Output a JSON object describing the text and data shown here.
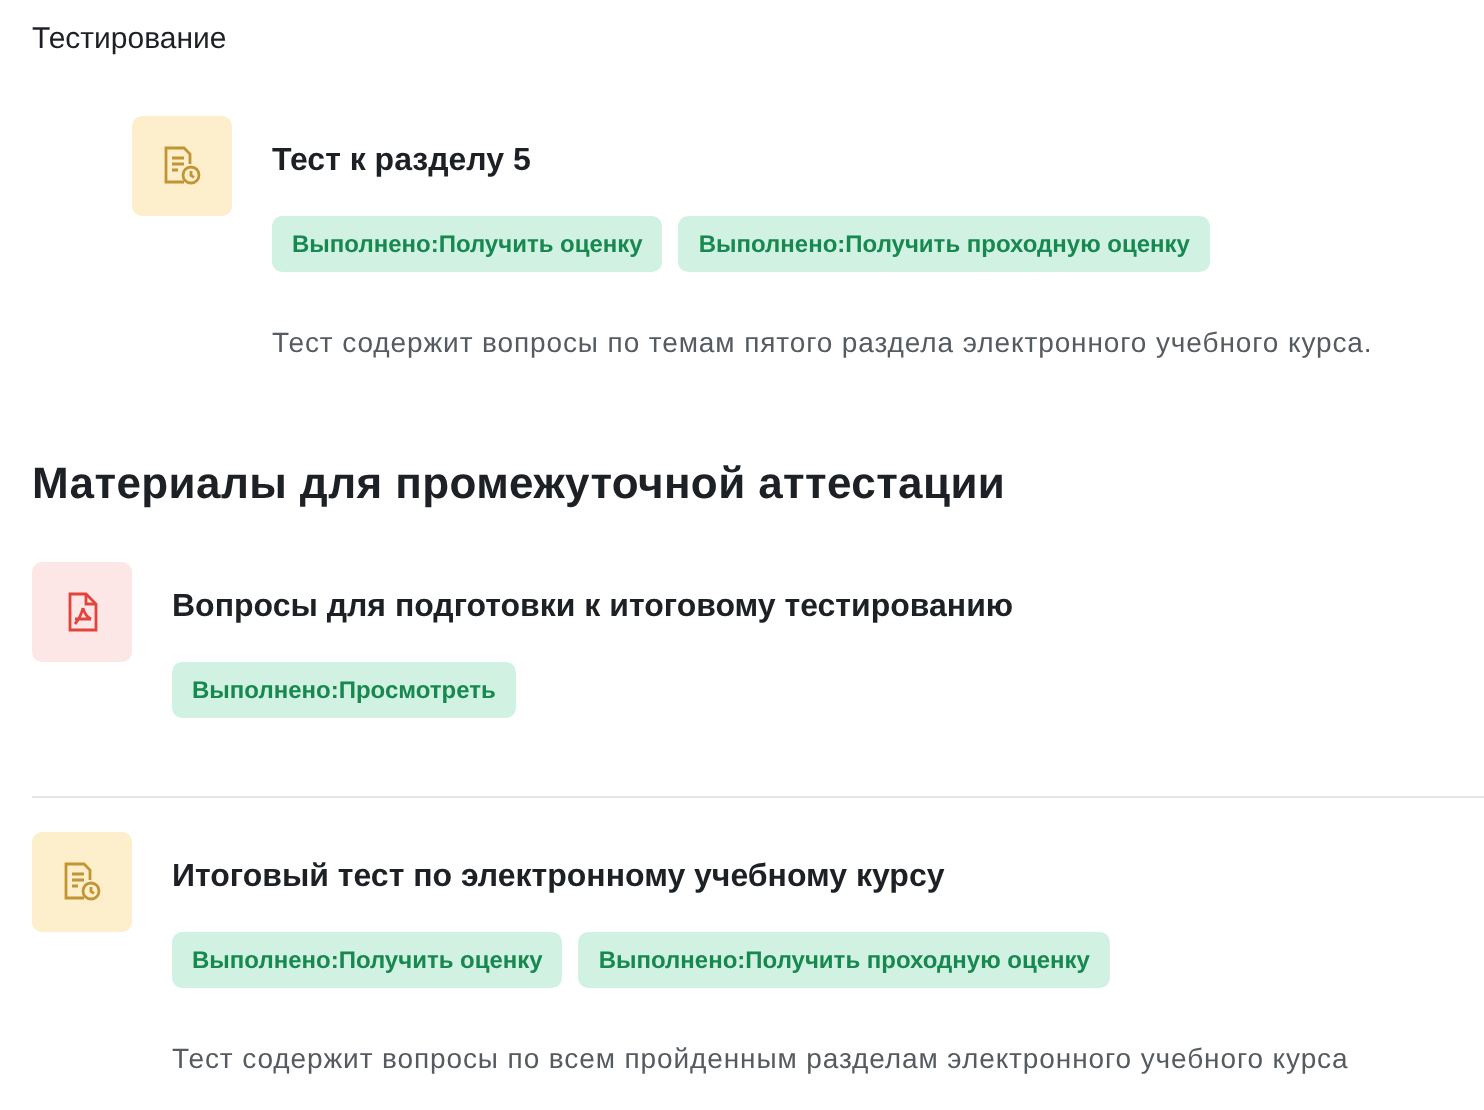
{
  "section_title": "Тестирование",
  "section_activities": [
    {
      "kind": "quiz",
      "title": "Тест к разделу 5",
      "badges": [
        "Выполнено:Получить оценку",
        "Выполнено:Получить проходную оценку"
      ],
      "description": "Тест содержит вопросы по темам пятого раздела электронного учебного курса."
    }
  ],
  "heading": "Материалы для промежуточной аттестации",
  "activities": [
    {
      "kind": "pdf",
      "title": "Вопросы для подготовки к итоговому тестированию",
      "badges": [
        "Выполнено:Просмотреть"
      ]
    },
    {
      "kind": "quiz",
      "title": "Итоговый тест по электронному учебному курсу",
      "badges": [
        "Выполнено:Получить оценку",
        "Выполнено:Получить проходную оценку"
      ],
      "description": "Тест содержит вопросы по всем пройденным разделам электронного учебного курса"
    }
  ]
}
